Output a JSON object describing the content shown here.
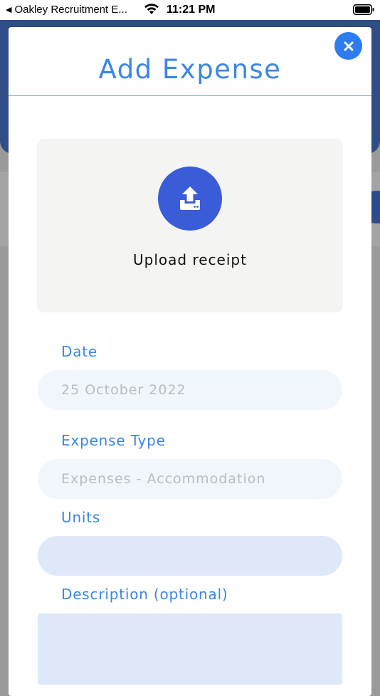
{
  "status_bar": {
    "back_app": "Oakley Recruitment E...",
    "time": "11:21 PM"
  },
  "modal": {
    "title": "Add Expense",
    "close_icon": "close-icon",
    "upload": {
      "label": "Upload receipt",
      "icon": "upload-icon"
    },
    "fields": {
      "date": {
        "label": "Date",
        "value": "25 October 2022"
      },
      "expense_type": {
        "label": "Expense Type",
        "value": "Expenses - Accommodation"
      },
      "units": {
        "label": "Units",
        "value": ""
      },
      "description": {
        "label": "Description (optional)",
        "value": ""
      }
    }
  },
  "colors": {
    "accent": "#3a86e6",
    "close_button": "#2d7df1",
    "upload_circle": "#3a5cd8",
    "header_bg": "#2f4d86"
  }
}
